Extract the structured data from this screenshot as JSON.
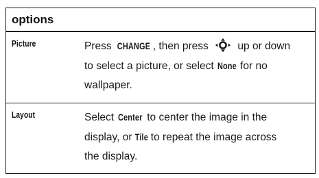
{
  "header": {
    "title": "options"
  },
  "rows": [
    {
      "term": "Picture",
      "desc": {
        "t1": "Press ",
        "k1": "CHANGE",
        "t2": ", then press ",
        "t3": " up or down",
        "t4": "to select a picture, or select ",
        "k2": "None",
        "t5": " for no",
        "t6": "wallpaper.",
        "icon": "nav-key-icon"
      }
    },
    {
      "term": "Layout",
      "desc": {
        "t1": "Select ",
        "k1": "Center",
        "t2": " to center the image in the",
        "t3": "display, or ",
        "k2": "Tile",
        "t4": " to repeat the image across",
        "t5": "the display."
      }
    }
  ]
}
